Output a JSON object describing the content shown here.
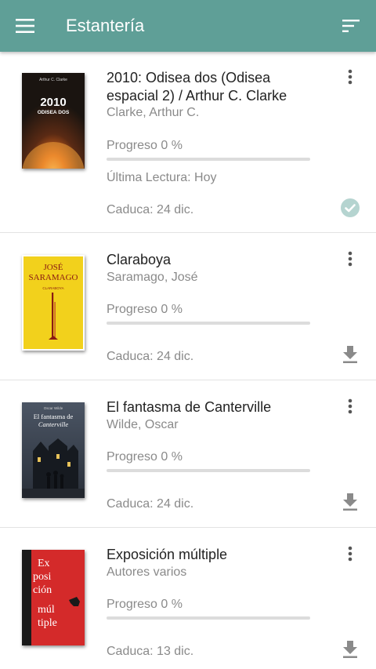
{
  "appbar": {
    "title": "Estantería",
    "menu_icon": "hamburger-menu-icon",
    "sort_icon": "sort-icon",
    "color": "#5f9f97"
  },
  "books": [
    {
      "title": "2010: Odisea dos (Odisea espacial 2)  / Arthur C. Clarke",
      "author": "Clarke, Arthur C.",
      "progress_label": "Progreso 0 %",
      "progress": 0,
      "last_read": "Última Lectura: Hoy",
      "due": "Caduca: 24 dic.",
      "status_icon": "downloaded-check-icon",
      "cover": {
        "author": "Arthur C. Clarke",
        "title_line1": "2010",
        "title_line2": "ODISEA DOS"
      }
    },
    {
      "title": "Claraboya",
      "author": "Saramago, José",
      "progress_label": "Progreso 0 %",
      "progress": 0,
      "due": "Caduca: 24 dic.",
      "status_icon": "download-icon",
      "cover": {
        "author_line1": "JOSÉ",
        "author_line2": "SARAMAGO",
        "title": "CLARABOYA"
      }
    },
    {
      "title": "El fantasma de Canterville",
      "author": "Wilde, Oscar",
      "progress_label": "Progreso 0 %",
      "progress": 0,
      "due": "Caduca: 24 dic.",
      "status_icon": "download-icon",
      "cover": {
        "author": "Oscar Wilde",
        "title_line1": "El fantasma de",
        "title_line2": "Canterville"
      }
    },
    {
      "title": "Exposición múltiple",
      "author": "Autores varios",
      "progress_label": "Progreso 0 %",
      "progress": 0,
      "due": "Caduca: 13 dic.",
      "status_icon": "download-icon",
      "cover": {
        "line1": "Ex",
        "line2": "posi",
        "line3": "ción",
        "line4": "múl",
        "line5": "tiple"
      }
    }
  ]
}
